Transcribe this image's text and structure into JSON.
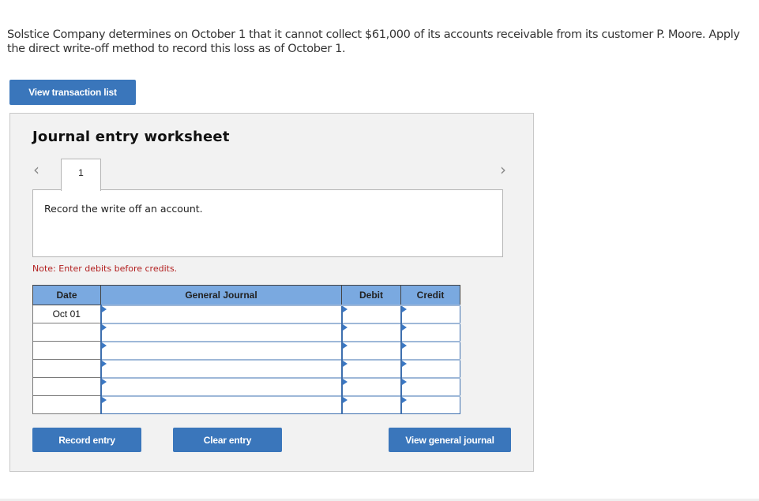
{
  "question": {
    "text": "Solstice Company determines on October 1 that it cannot collect $61,000 of its accounts receivable from its customer P. Moore. Apply the direct write-off method to record this loss as of October 1."
  },
  "buttons": {
    "view_transaction_list": "View transaction list",
    "record_entry": "Record entry",
    "clear_entry": "Clear entry",
    "view_general_journal": "View general journal"
  },
  "worksheet": {
    "title": "Journal entry worksheet",
    "nav_prev_icon": "‹",
    "nav_next_icon": "›",
    "tabs": [
      {
        "label": "1",
        "active": true
      }
    ],
    "description": "Record the write off an account.",
    "note": "Note: Enter debits before credits."
  },
  "journal": {
    "headers": {
      "date": "Date",
      "general_journal": "General Journal",
      "debit": "Debit",
      "credit": "Credit"
    },
    "rows": [
      {
        "date": "Oct 01",
        "account": "",
        "debit": "",
        "credit": ""
      },
      {
        "date": "",
        "account": "",
        "debit": "",
        "credit": ""
      },
      {
        "date": "",
        "account": "",
        "debit": "",
        "credit": ""
      },
      {
        "date": "",
        "account": "",
        "debit": "",
        "credit": ""
      },
      {
        "date": "",
        "account": "",
        "debit": "",
        "credit": ""
      },
      {
        "date": "",
        "account": "",
        "debit": "",
        "credit": ""
      }
    ]
  },
  "colors": {
    "button_blue": "#3a76bb",
    "header_blue": "#7aa9e0",
    "note_red": "#b21e1e",
    "panel_gray": "#f2f2f2"
  }
}
